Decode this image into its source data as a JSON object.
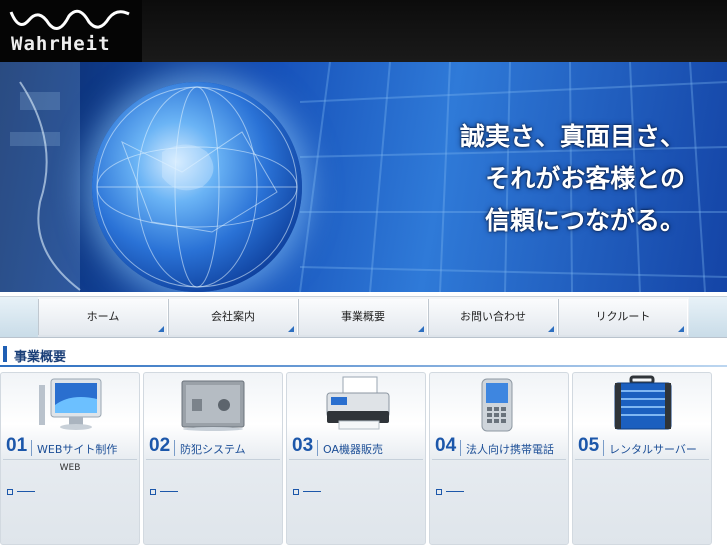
{
  "header": {
    "logo_text": "WahrHeit"
  },
  "hero": {
    "lines": [
      "誠実さ、真面目さ、",
      "それがお客様との",
      "信頼につながる。"
    ]
  },
  "nav": {
    "items": [
      "ホーム",
      "会社案内",
      "事業概要",
      "お問い合わせ",
      "リクルート"
    ]
  },
  "section": {
    "title": "事業概要"
  },
  "services": [
    {
      "num": "01",
      "title": "WEBサイト制作",
      "desc": "WEB",
      "icon": "monitor-icon"
    },
    {
      "num": "02",
      "title": "防犯システム",
      "desc": "",
      "icon": "safe-icon"
    },
    {
      "num": "03",
      "title": "OA機器販売",
      "desc": "",
      "icon": "printer-icon"
    },
    {
      "num": "04",
      "title": "法人向け携帯電話",
      "desc": "",
      "icon": "phone-icon"
    },
    {
      "num": "05",
      "title": "レンタルサーバー",
      "desc": "",
      "icon": "server-case-icon"
    }
  ],
  "colors": {
    "accent": "#1c57aa",
    "nav_marker": "#2d6fc0",
    "header_bg": "#0c0c0c"
  }
}
